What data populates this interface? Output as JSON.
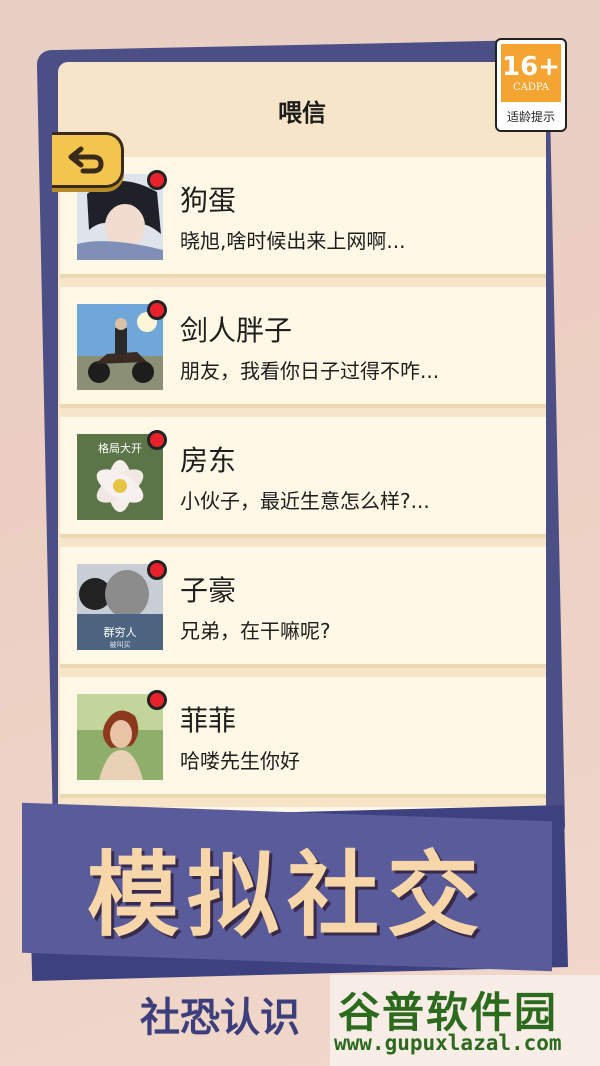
{
  "header": {
    "title": "喂信"
  },
  "age_rating": {
    "number": "16+",
    "org": "CADPA",
    "caption": "适龄提示"
  },
  "back_button": {
    "icon": "back-arrow-icon"
  },
  "chats": [
    {
      "name": "狗蛋",
      "preview": "晓旭,啥时候出来上网啊...",
      "unread": true
    },
    {
      "name": "剑人胖子",
      "preview": "朋友，我看你日子过得不咋...",
      "unread": true
    },
    {
      "name": "房东",
      "preview": "小伙子，最近生意怎么样?...",
      "unread": true,
      "avatar_caption": "格局大开"
    },
    {
      "name": "子豪",
      "preview": "兄弟，在干嘛呢?",
      "unread": true,
      "avatar_caption": "群穷人",
      "avatar_subcaption": "被叫买"
    },
    {
      "name": "菲菲",
      "preview": "哈喽先生你好",
      "unread": true
    }
  ],
  "banner": {
    "title": "模拟社交"
  },
  "subtitle": "社恐认识",
  "watermark": {
    "title": "谷普软件园",
    "url": "www.gupuxlazal.com"
  },
  "colors": {
    "frame": "#4b4f86",
    "screen": "#f6e5c8",
    "row": "#fff8e6",
    "unread": "#e8222a",
    "banner": "#5a5b9a",
    "banner_text": "#f7d7a9",
    "back_button": "#f4c54d",
    "age_badge": "#f3a431"
  }
}
